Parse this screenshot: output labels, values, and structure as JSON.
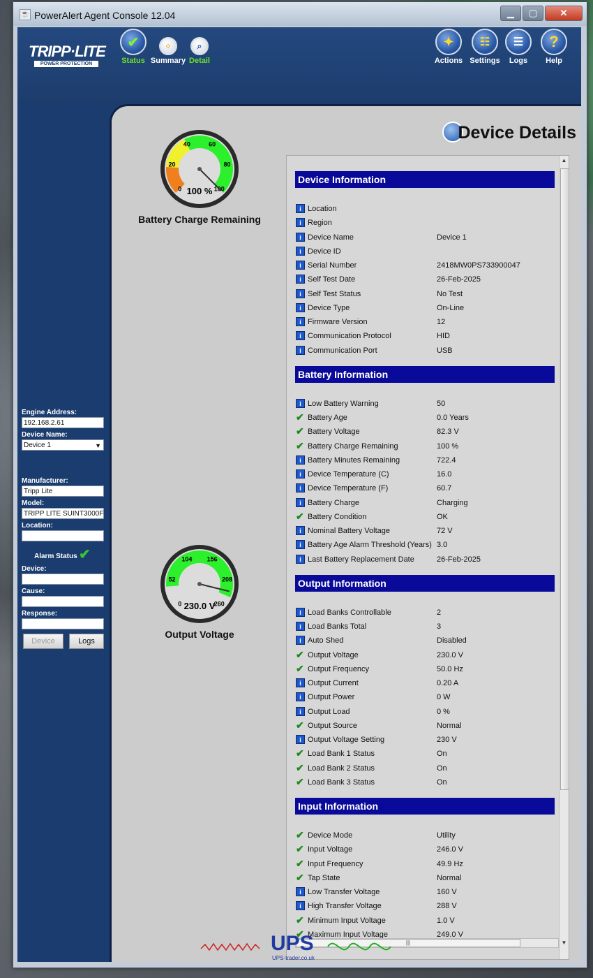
{
  "window": {
    "title": "PowerAlert Agent Console 12.04"
  },
  "logo": {
    "main": "TRIPP·LITE",
    "sub": "POWER PROTECTION"
  },
  "nav_left": [
    {
      "label": "Status",
      "icon": "check-icon"
    },
    {
      "label": "Summary",
      "icon": "dots-icon"
    },
    {
      "label": "Detail",
      "icon": "magnifier-icon"
    }
  ],
  "nav_right": [
    {
      "label": "Actions",
      "icon": "actions-icon"
    },
    {
      "label": "Settings",
      "icon": "settings-icon"
    },
    {
      "label": "Logs",
      "icon": "logs-icon"
    },
    {
      "label": "Help",
      "icon": "help-icon",
      "glyph": "?"
    }
  ],
  "page_title": "Device Details",
  "gauges": {
    "battery": {
      "caption": "Battery Charge Remaining",
      "readout": "100 %",
      "ticks": [
        "0",
        "20",
        "40",
        "60",
        "80",
        "100"
      ],
      "value": 100
    },
    "voltage": {
      "caption": "Output Voltage",
      "readout": "230.0 V",
      "ticks": [
        "0",
        "52",
        "104",
        "156",
        "208",
        "260"
      ],
      "value": 230
    }
  },
  "sections": [
    {
      "title": "Device Information",
      "rows": [
        {
          "icon": "info",
          "label": "Location",
          "value": ""
        },
        {
          "icon": "info",
          "label": "Region",
          "value": ""
        },
        {
          "icon": "info",
          "label": "Device Name",
          "value": "Device 1"
        },
        {
          "icon": "info",
          "label": "Device ID",
          "value": ""
        },
        {
          "icon": "info",
          "label": "Serial Number",
          "value": "2418MW0PS733900047"
        },
        {
          "icon": "info",
          "label": "Self Test Date",
          "value": "26-Feb-2025"
        },
        {
          "icon": "info",
          "label": "Self Test Status",
          "value": "No Test"
        },
        {
          "icon": "info",
          "label": "Device Type",
          "value": "On-Line"
        },
        {
          "icon": "info",
          "label": "Firmware Version",
          "value": "12"
        },
        {
          "icon": "info",
          "label": "Communication Protocol",
          "value": "HID"
        },
        {
          "icon": "info",
          "label": "Communication Port",
          "value": "USB"
        }
      ]
    },
    {
      "title": "Battery Information",
      "rows": [
        {
          "icon": "info",
          "label": "Low Battery Warning",
          "value": "50"
        },
        {
          "icon": "ok",
          "label": "Battery Age",
          "value": "0.0 Years"
        },
        {
          "icon": "ok",
          "label": "Battery Voltage",
          "value": "82.3 V"
        },
        {
          "icon": "ok",
          "label": "Battery Charge Remaining",
          "value": "100 %"
        },
        {
          "icon": "info",
          "label": "Battery Minutes Remaining",
          "value": "722.4"
        },
        {
          "icon": "info",
          "label": "Device Temperature (C)",
          "value": "16.0"
        },
        {
          "icon": "info",
          "label": "Device Temperature (F)",
          "value": "60.7"
        },
        {
          "icon": "info",
          "label": "Battery Charge",
          "value": "Charging"
        },
        {
          "icon": "ok",
          "label": "Battery Condition",
          "value": "OK"
        },
        {
          "icon": "info",
          "label": "Nominal Battery Voltage",
          "value": "72 V"
        },
        {
          "icon": "info",
          "label": "Battery Age Alarm Threshold (Years)",
          "value": "3.0"
        },
        {
          "icon": "info",
          "label": "Last Battery Replacement Date",
          "value": "26-Feb-2025"
        }
      ]
    },
    {
      "title": "Output Information",
      "rows": [
        {
          "icon": "info",
          "label": "Load Banks Controllable",
          "value": "2"
        },
        {
          "icon": "info",
          "label": "Load Banks Total",
          "value": "3"
        },
        {
          "icon": "info",
          "label": "Auto Shed",
          "value": "Disabled"
        },
        {
          "icon": "ok",
          "label": "Output Voltage",
          "value": "230.0 V"
        },
        {
          "icon": "ok",
          "label": "Output Frequency",
          "value": "50.0 Hz"
        },
        {
          "icon": "info",
          "label": "Output Current",
          "value": "0.20 A"
        },
        {
          "icon": "info",
          "label": "Output Power",
          "value": "0 W"
        },
        {
          "icon": "info",
          "label": "Output Load",
          "value": "0 %"
        },
        {
          "icon": "ok",
          "label": "Output Source",
          "value": "Normal"
        },
        {
          "icon": "info",
          "label": "Output Voltage Setting",
          "value": "230 V"
        },
        {
          "icon": "ok",
          "label": "Load Bank 1 Status",
          "value": "On"
        },
        {
          "icon": "ok",
          "label": "Load Bank 2 Status",
          "value": "On"
        },
        {
          "icon": "ok",
          "label": "Load Bank 3 Status",
          "value": "On"
        }
      ]
    },
    {
      "title": "Input Information",
      "rows": [
        {
          "icon": "ok",
          "label": "Device Mode",
          "value": "Utility"
        },
        {
          "icon": "ok",
          "label": "Input Voltage",
          "value": "246.0 V"
        },
        {
          "icon": "ok",
          "label": "Input Frequency",
          "value": "49.9 Hz"
        },
        {
          "icon": "ok",
          "label": "Tap State",
          "value": "Normal"
        },
        {
          "icon": "info",
          "label": "Low Transfer Voltage",
          "value": "160 V"
        },
        {
          "icon": "info",
          "label": "High Transfer Voltage",
          "value": "288 V"
        },
        {
          "icon": "ok",
          "label": "Minimum Input Voltage",
          "value": "1.0 V"
        },
        {
          "icon": "ok",
          "label": "Maximum Input Voltage",
          "value": "249.0 V"
        }
      ]
    }
  ],
  "sidebar": {
    "engine_address_label": "Engine Address:",
    "engine_address": "192.168.2.61",
    "device_name_label": "Device Name:",
    "device_name": "Device 1",
    "manufacturer_label": "Manufacturer:",
    "manufacturer": "Tripp Lite",
    "model_label": "Model:",
    "model": "TRIPP LITE SUINT3000F",
    "location_label": "Location:",
    "location": "",
    "alarm_status_label": "Alarm Status",
    "device_label": "Device:",
    "cause_label": "Cause:",
    "response_label": "Response:",
    "device_button": "Device",
    "logs_button": "Logs"
  },
  "watermark": {
    "brand": "UPS",
    "site": "UPS-trader.co.uk"
  },
  "colors": {
    "section_header": "#0a0a9a",
    "nav_active": "#6ee02a",
    "sidebar_bg": "#1b3c6f",
    "ok_green": "#1d8a1d",
    "info_blue": "#1f58c9"
  }
}
